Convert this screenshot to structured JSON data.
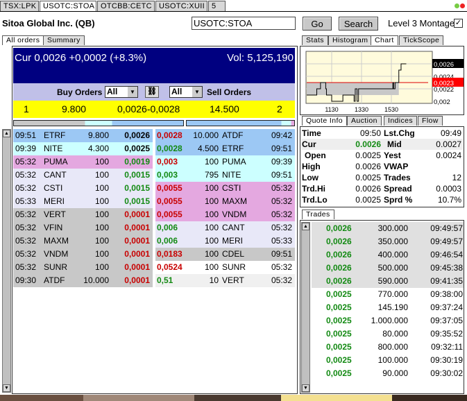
{
  "tabs": [
    "TSX:LPK",
    "USOTC:STOA",
    "OTCBB:CETC",
    "USOTC:XUII",
    "5"
  ],
  "selected_tab": 1,
  "header": {
    "company": "Sitoa Global Inc. (QB)",
    "symbol_value": "USOTC:STOA",
    "go_label": "Go",
    "search_label": "Search",
    "montage_label": "Level 3 Montage",
    "montage_checked": true
  },
  "left_tabs": [
    "All orders",
    "Summary"
  ],
  "summary": {
    "cur": "Cur 0,0026 +0,0002 (+8.3%)",
    "vol": "Vol: 5,125,190"
  },
  "filters": {
    "buy_label": "Buy Orders",
    "buy_value": "All",
    "sell_value": "All",
    "sell_label": "Sell Orders"
  },
  "best": {
    "bid_count": "1",
    "bid_size": "9.800",
    "spread": "0,0026-0,0028",
    "ask_size": "14.500",
    "ask_count": "2"
  },
  "bids": [
    {
      "time": "09:51",
      "mm": "ETRF",
      "size": "9.800",
      "price": "0,0026",
      "pc": "b",
      "bg": "#9cc8f4"
    },
    {
      "time": "09:39",
      "mm": "NITE",
      "size": "4.300",
      "price": "0,0025",
      "pc": "b",
      "bg": "#ccffff"
    },
    {
      "time": "05:32",
      "mm": "PUMA",
      "size": "100",
      "price": "0,0019",
      "pc": "g",
      "bg": "#e4a8e0"
    },
    {
      "time": "05:32",
      "mm": "CANT",
      "size": "100",
      "price": "0,0015",
      "pc": "g",
      "bg": "#e8e8f8"
    },
    {
      "time": "05:32",
      "mm": "CSTI",
      "size": "100",
      "price": "0,0015",
      "pc": "g",
      "bg": "#e8e8f8"
    },
    {
      "time": "05:33",
      "mm": "MERI",
      "size": "100",
      "price": "0,0015",
      "pc": "g",
      "bg": "#e8e8f8"
    },
    {
      "time": "05:32",
      "mm": "VERT",
      "size": "100",
      "price": "0,0001",
      "pc": "red",
      "bg": "#c8c8c8"
    },
    {
      "time": "05:32",
      "mm": "VFIN",
      "size": "100",
      "price": "0,0001",
      "pc": "red",
      "bg": "#c8c8c8"
    },
    {
      "time": "05:32",
      "mm": "MAXM",
      "size": "100",
      "price": "0,0001",
      "pc": "red",
      "bg": "#c8c8c8"
    },
    {
      "time": "05:32",
      "mm": "VNDM",
      "size": "100",
      "price": "0,0001",
      "pc": "red",
      "bg": "#c8c8c8"
    },
    {
      "time": "05:32",
      "mm": "SUNR",
      "size": "100",
      "price": "0,0001",
      "pc": "red",
      "bg": "#c8c8c8"
    },
    {
      "time": "09:30",
      "mm": "ATDF",
      "size": "10.000",
      "price": "0,0001",
      "pc": "red",
      "bg": "#c8c8c8"
    }
  ],
  "asks": [
    {
      "price": "0,0028",
      "pc": "red",
      "size": "10.000",
      "mm": "ATDF",
      "time": "09:42",
      "bg": "#9cc8f4"
    },
    {
      "price": "0,0028",
      "pc": "g",
      "size": "4.500",
      "mm": "ETRF",
      "time": "09:51",
      "bg": "#9cc8f4"
    },
    {
      "price": "0,003",
      "pc": "red",
      "size": "100",
      "mm": "PUMA",
      "time": "09:39",
      "bg": "#ccffff"
    },
    {
      "price": "0,003",
      "pc": "g",
      "size": "795",
      "mm": "NITE",
      "time": "09:51",
      "bg": "#ccffff"
    },
    {
      "price": "0,0055",
      "pc": "red",
      "size": "100",
      "mm": "CSTI",
      "time": "05:32",
      "bg": "#e4a8e0"
    },
    {
      "price": "0,0055",
      "pc": "red",
      "size": "100",
      "mm": "MAXM",
      "time": "05:32",
      "bg": "#e4a8e0"
    },
    {
      "price": "0,0055",
      "pc": "red",
      "size": "100",
      "mm": "VNDM",
      "time": "05:32",
      "bg": "#e4a8e0"
    },
    {
      "price": "0,006",
      "pc": "g",
      "size": "100",
      "mm": "CANT",
      "time": "05:32",
      "bg": "#e8e8f8"
    },
    {
      "price": "0,006",
      "pc": "g",
      "size": "100",
      "mm": "MERI",
      "time": "05:33",
      "bg": "#e8e8f8"
    },
    {
      "price": "0,0183",
      "pc": "red",
      "size": "100",
      "mm": "CDEL",
      "time": "09:51",
      "bg": "#c8c8c8"
    },
    {
      "price": "0,0524",
      "pc": "red",
      "size": "100",
      "mm": "SUNR",
      "time": "05:32",
      "bg": "#ffffff"
    },
    {
      "price": "0,51",
      "pc": "g",
      "size": "10",
      "mm": "VERT",
      "time": "05:32",
      "bg": "#f0f0f0"
    }
  ],
  "right_tabs": [
    "Stats",
    "Histogram",
    "Chart",
    "TickScope"
  ],
  "chart_data": {
    "type": "line",
    "x_ticks": [
      "1130",
      "1330",
      "1530"
    ],
    "y_ticks": [
      "0,0026",
      "0,0024",
      "0,0023",
      "0,0022",
      "0,002"
    ],
    "last_price": "0,0026",
    "reference_price": "0,0023",
    "grid": true,
    "x": [
      9.75,
      10.4,
      10.5,
      10.75,
      11.0,
      11.1,
      11.15,
      11.5,
      12.25,
      12.9,
      13.0,
      13.08,
      13.15,
      13.2,
      13.3,
      15.0,
      15.6,
      15.65,
      15.75,
      16.0,
      16.15,
      16.25,
      16.5
    ],
    "values": [
      0.0021,
      0.0021,
      0.0022,
      0.0023,
      0.0023,
      0.0022,
      0.0021,
      0.002,
      0.0021,
      0.0021,
      0.002,
      0.0022,
      0.0022,
      0.002,
      0.0022,
      0.0022,
      0.0023,
      0.0022,
      0.0023,
      0.0025,
      0.0026,
      0.0026,
      0.0026
    ]
  },
  "quote_tabs": [
    "Quote Info",
    "Auction",
    "Indices",
    "Flow"
  ],
  "quote": [
    [
      "Time",
      "09:50",
      "Lst.Chg",
      "09:49"
    ],
    [
      "Cur",
      "0.0026",
      "Mid",
      "0.0027"
    ],
    [
      "Open",
      "0.0025",
      "Yest",
      "0.0024"
    ],
    [
      "High",
      "0.0026",
      "VWAP",
      ""
    ],
    [
      "Low",
      "0.0025",
      "Trades",
      "12"
    ],
    [
      "Trd.Hi",
      "0.0026",
      "Spread",
      "0.0003"
    ],
    [
      "Trd.Lo",
      "0.0025",
      "Sprd %",
      "10.7%"
    ]
  ],
  "trades_tab": "Trades",
  "trades": [
    [
      "0,0026",
      "300.000",
      "09:49:57"
    ],
    [
      "0,0026",
      "350.000",
      "09:49:57"
    ],
    [
      "0,0026",
      "400.000",
      "09:46:54"
    ],
    [
      "0,0026",
      "500.000",
      "09:45:38"
    ],
    [
      "0,0026",
      "590.000",
      "09:41:35"
    ],
    [
      "0,0025",
      "770.000",
      "09:38:00"
    ],
    [
      "0,0025",
      "145.190",
      "09:37:24"
    ],
    [
      "0,0025",
      "1.000.000",
      "09:37:05"
    ],
    [
      "0,0025",
      "80.000",
      "09:35:52"
    ],
    [
      "0,0025",
      "800.000",
      "09:32:11"
    ],
    [
      "0,0025",
      "100.000",
      "09:30:19"
    ],
    [
      "0,0025",
      "90.000",
      "09:30:02"
    ]
  ],
  "colors": {
    "header_bg": "#000080",
    "filter_bg": "#c0c0e8",
    "best_bg": "#ffff00",
    "green": "#138a13",
    "red": "#c80000",
    "chart_bg": "#fffbdc"
  }
}
